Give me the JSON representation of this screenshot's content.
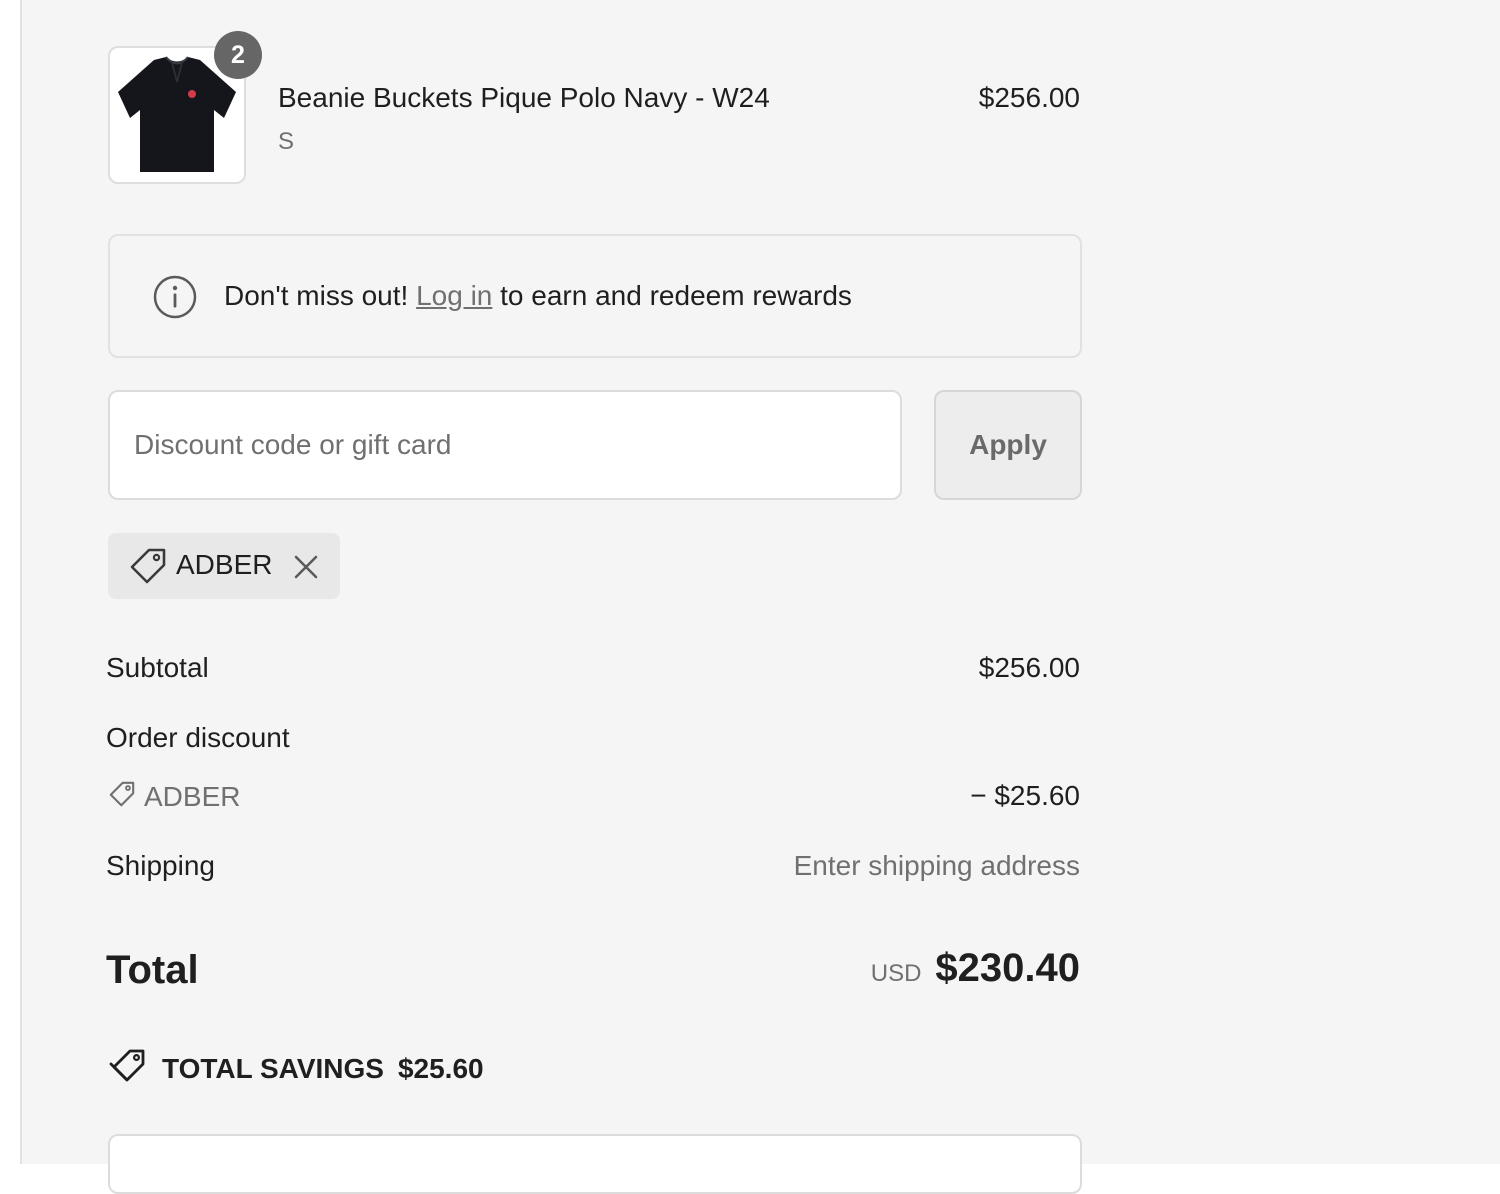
{
  "product": {
    "name": "Beanie Buckets Pique Polo Navy - W24",
    "variant": "S",
    "price": "$256.00",
    "quantity": "2",
    "image_icon": "polo-shirt-icon"
  },
  "rewards_banner": {
    "icon": "info-icon",
    "prefix": "Don't miss out!",
    "link_label": "Log in",
    "suffix": "to earn and redeem rewards"
  },
  "discount": {
    "placeholder": "Discount code or gift card",
    "value": "",
    "apply_label": "Apply"
  },
  "applied_code": {
    "icon": "tag-icon",
    "code": "ADBER",
    "remove_icon": "close-icon"
  },
  "summary": {
    "subtotal_label": "Subtotal",
    "subtotal_value": "$256.00",
    "order_discount_label": "Order discount",
    "discount_code": "ADBER",
    "discount_value": "− $25.60",
    "shipping_label": "Shipping",
    "shipping_value": "Enter shipping address",
    "total_label": "Total",
    "currency": "USD",
    "total_value": "$230.40",
    "savings_icon": "tags-icon",
    "savings_label": "TOTAL SAVINGS",
    "savings_value": "$25.60"
  },
  "colors": {
    "panel_background": "#f5f5f5",
    "badge": "#666666",
    "muted_text": "#707070",
    "text": "#1f1f1f"
  }
}
